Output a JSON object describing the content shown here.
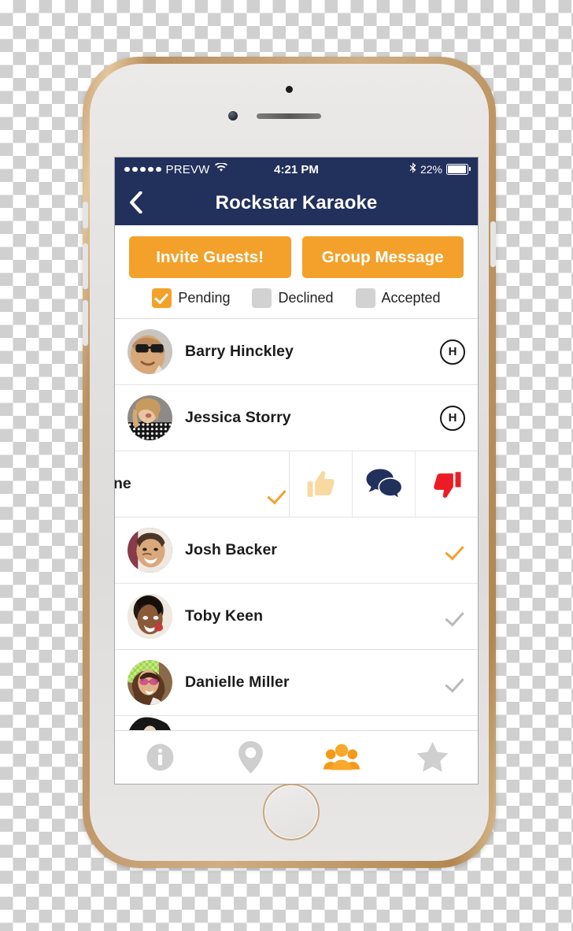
{
  "device": {
    "frame_name": "iphone-gold-white",
    "home_button": "home-button"
  },
  "statusbar": {
    "carrier": "PREVW",
    "signal_dots": 5,
    "wifi_icon": "wifi-icon",
    "time": "4:21 PM",
    "bluetooth_icon": "bluetooth-icon",
    "battery_percent": "22%"
  },
  "navbar": {
    "back_icon": "chevron-left-icon",
    "title": "Rockstar Karaoke"
  },
  "toolbar": {
    "invite_label": "Invite Guests!",
    "group_message_label": "Group Message"
  },
  "filters": [
    {
      "label": "Pending",
      "checked": true
    },
    {
      "label": "Declined",
      "checked": false
    },
    {
      "label": "Accepted",
      "checked": false
    }
  ],
  "guests": [
    {
      "name": "Barry Hinckley",
      "badge": "H",
      "badge_type": "host"
    },
    {
      "name": "Jessica Storry",
      "badge": "H",
      "badge_type": "host"
    },
    {
      "name": "ne",
      "badge": "check",
      "badge_type": "check-orange",
      "swiped": true
    },
    {
      "name": "Josh Backer",
      "badge": "check",
      "badge_type": "check-orange"
    },
    {
      "name": "Toby Keen",
      "badge": "check",
      "badge_type": "check-grey"
    },
    {
      "name": "Danielle Miller",
      "badge": "check",
      "badge_type": "check-grey"
    },
    {
      "name": "",
      "badge": "",
      "badge_type": "partial"
    }
  ],
  "swipe_actions": [
    {
      "name": "thumbs-up-icon",
      "color": "#f8d9a0"
    },
    {
      "name": "chat-bubbles-icon",
      "color": "#22305c"
    },
    {
      "name": "thumbs-down-icon",
      "color": "#ec1c24"
    }
  ],
  "tabs": [
    {
      "icon": "info-icon",
      "active": false
    },
    {
      "icon": "map-pin-icon",
      "active": false
    },
    {
      "icon": "people-icon",
      "active": true
    },
    {
      "icon": "star-icon",
      "active": false
    }
  ],
  "colors": {
    "navy": "#22305c",
    "orange": "#f3a12b",
    "grey": "#d2d2d2",
    "red": "#ec1c24",
    "light_orange": "#f8d9a0"
  }
}
